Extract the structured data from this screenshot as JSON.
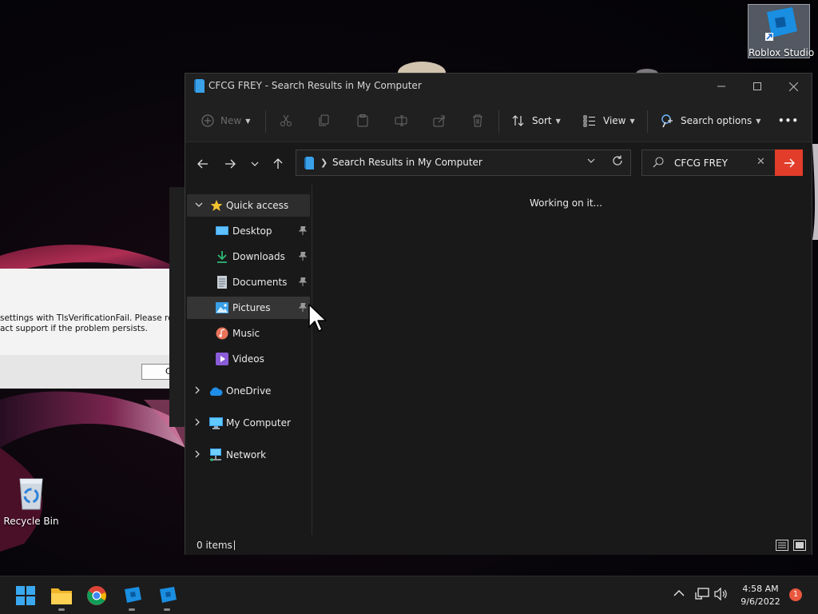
{
  "desktop": {
    "icons": [
      {
        "label": "Roblox Studio"
      },
      {
        "label": "Recycle Bin"
      }
    ],
    "background_dialog": {
      "message_line1": "settings with TlsVerificationFail. Please res",
      "message_line2": "act support if the problem persists.",
      "button_label": "C"
    }
  },
  "explorer": {
    "title": "CFCG FREY - Search Results in My Computer",
    "toolbar": {
      "new_label": "New",
      "sort_label": "Sort",
      "view_label": "View",
      "search_options_label": "Search options",
      "more_label": "•••"
    },
    "address": {
      "path": "Search Results in My Computer"
    },
    "search": {
      "value": "CFCG FREY"
    },
    "sidebar": {
      "quick_access": "Quick access",
      "items": [
        {
          "label": "Desktop"
        },
        {
          "label": "Downloads"
        },
        {
          "label": "Documents"
        },
        {
          "label": "Pictures"
        },
        {
          "label": "Music"
        },
        {
          "label": "Videos"
        }
      ],
      "onedrive": "OneDrive",
      "my_computer": "My Computer",
      "network": "Network"
    },
    "content": {
      "status": "Working on it..."
    },
    "statusbar": {
      "item_count": "0 items"
    }
  },
  "taskbar": {
    "time": "4:58 AM",
    "date": "9/6/2022",
    "notification_count": "1"
  },
  "colors": {
    "accent_red": "#e23c2b",
    "explorer_bg": "#191919",
    "chrome_bg": "#202020",
    "taskbar_bg": "#1c1c1c"
  }
}
